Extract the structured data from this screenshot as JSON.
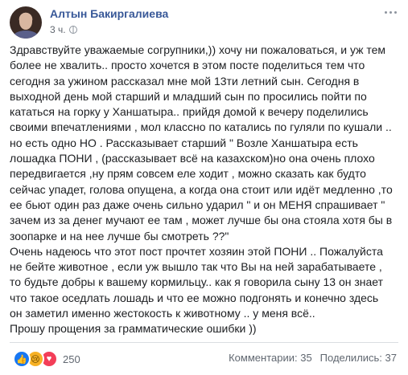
{
  "post": {
    "author": "Алтын Бакиргалиева",
    "time": "3 ч.",
    "menu_icon": "more-horizontal-icon",
    "privacy_icon": "globe-icon",
    "lines": [
      "Здравствуйте уважаемые согрупники,)) хочу ни пожаловаться, и уж тем",
      "более не хвалить.. просто хочется в этом посте поделиться тем что",
      "сегодня за ужином рассказал мне мой 13ти летний сын. Сегодня в",
      "выходной день мой старший и младший сын по просились пойти по",
      "кататься на горку у Ханшатыра.. прийдя домой к вечеру поделились",
      "своими впечатлениями , мол классно по катались по гуляли по кушали ..",
      "но есть одно НО . Рассказывает старший \" Возле Ханшатыра есть",
      "лошадка ПОНИ , (рассказывает всё на казахском)но она очень плохо",
      "передвигается ,ну прям совсем еле ходит , можно сказать как будто",
      "сейчас упадет, голова опущена, а когда она стоит или идёт медленно ,то",
      "ее бьют один раз даже очень сильно ударил \" и он МЕНЯ спрашивает \"",
      "зачем из за денег мучают ее там , может лучше бы она стояла хотя бы в",
      "зоопарке и на нее лучше бы смотреть ??\"",
      "Очень надеюсь что этот пост прочтет хозяин этой ПОНИ .. Пожалуйста",
      "не бейте животное , если уж вышло так что Вы на ней зарабатываете ,",
      "то будьте добры к вашему кормильцу.. как я говорила сыну 13 он знает",
      "что такое оседлать лошадь и что ее можно подгонять и конечно здесь",
      "он заметил именно жестокость к животному .. у меня всё..",
      "Прошу прощения за грамматические ошибки ))"
    ]
  },
  "reactions": {
    "icons": [
      {
        "name": "like-reaction-icon",
        "glyph": "👍"
      },
      {
        "name": "sad-reaction-icon",
        "glyph": "😢"
      },
      {
        "name": "love-reaction-icon",
        "glyph": "♥"
      }
    ],
    "count": "250"
  },
  "stats": {
    "comments": "Комментарии: 35",
    "shares": "Поделились: 37"
  }
}
